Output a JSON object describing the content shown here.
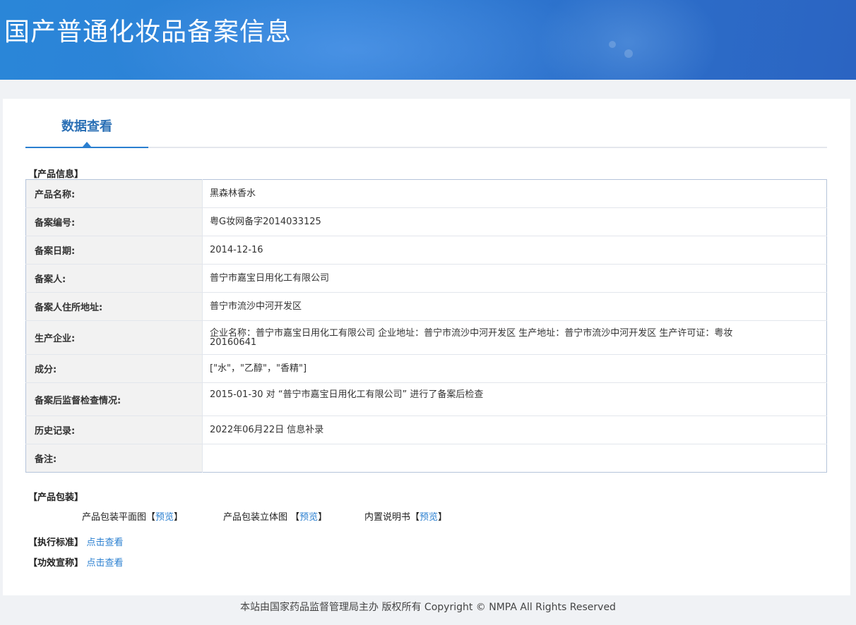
{
  "header": {
    "title": "国产普通化妆品备案信息"
  },
  "tabs": [
    {
      "label": "数据查看"
    }
  ],
  "product_info": {
    "section_title": "【产品信息】",
    "rows": [
      {
        "label": "产品名称:",
        "value": "黑森林香水"
      },
      {
        "label": "备案编号:",
        "value": "粤G妆网备字2014033125"
      },
      {
        "label": "备案日期:",
        "value": "2014-12-16"
      },
      {
        "label": "备案人:",
        "value": "普宁市嘉宝日用化工有限公司"
      },
      {
        "label": "备案人住所地址:",
        "value": "普宁市流沙中河开发区"
      },
      {
        "label": "生产企业:",
        "value": "企业名称：普宁市嘉宝日用化工有限公司 企业地址：普宁市流沙中河开发区 生产地址：普宁市流沙中河开发区 生产许可证：粤妆",
        "value2": "20160641"
      },
      {
        "label": "成分:",
        "value": "[\"水\"，\"乙醇\"，\"香精\"]"
      },
      {
        "label": "备案后监督检查情况:",
        "value": "2015-01-30 对 “普宁市嘉宝日用化工有限公司” 进行了备案后检查"
      },
      {
        "label": "历史记录:",
        "value": "2022年06月22日 信息补录"
      },
      {
        "label": "备注:",
        "value": ""
      }
    ]
  },
  "packaging": {
    "section_title": "【产品包装】",
    "items": [
      {
        "label": "产品包装平面图",
        "open": "【",
        "link": "预览",
        "close": "】"
      },
      {
        "label": "产品包装立体图 ",
        "open": "【",
        "link": "预览",
        "close": "】"
      },
      {
        "label": "内置说明书",
        "open": "【",
        "link": "预览",
        "close": "】"
      }
    ]
  },
  "standard": {
    "label": "【执行标准】",
    "link": "点击查看"
  },
  "efficacy": {
    "label": "【功效宣称】",
    "link": "点击查看"
  },
  "footer": {
    "text": "本站由国家药品监督管理局主办 版权所有 Copyright © NMPA All Rights Reserved"
  }
}
